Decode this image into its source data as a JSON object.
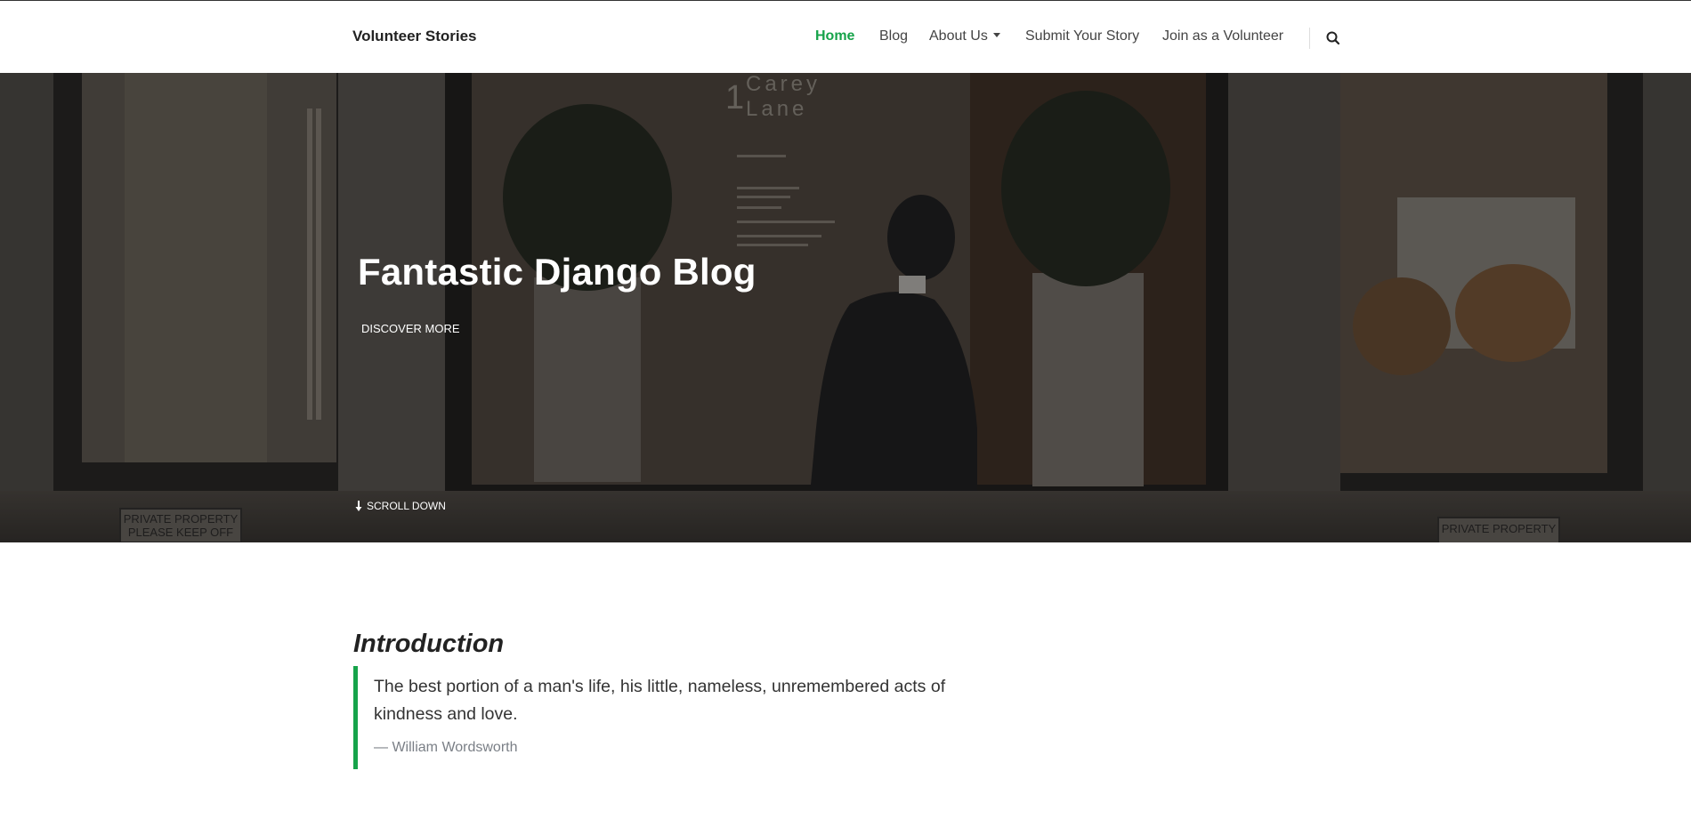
{
  "header": {
    "brand": "Volunteer Stories",
    "nav": [
      {
        "label": "Home",
        "active": true
      },
      {
        "label": "Blog",
        "active": false
      },
      {
        "label": "About Us",
        "active": false,
        "dropdown": true
      },
      {
        "label": "Submit Your Story",
        "active": false
      },
      {
        "label": "Join as a Volunteer",
        "active": false
      }
    ],
    "search_icon": "search-icon"
  },
  "hero": {
    "title": "Fantastic Django Blog",
    "cta": "DISCOVER MORE",
    "scroll": "SCROLL DOWN",
    "sign_text_1": "1",
    "sign_text_2": "Carey",
    "sign_text_3": "Lane",
    "private_sign_1": "PRIVATE PROPERTY",
    "private_sign_2": "PLEASE KEEP OFF"
  },
  "intro": {
    "heading": "Introduction",
    "quote": "The best portion of a man's life, his little, nameless, unremembered acts of kindness and love.",
    "author": "— William Wordsworth"
  },
  "colors": {
    "accent": "#16a34a",
    "hero_overlay": "#2b2a27"
  }
}
